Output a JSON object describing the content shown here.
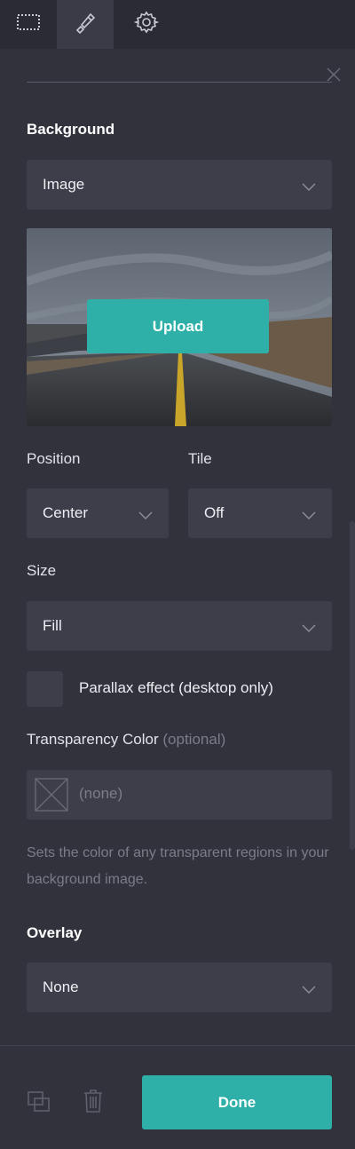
{
  "tabs": [
    {
      "name": "layout-tab",
      "icon": "dotted-rectangle-icon"
    },
    {
      "name": "style-tab",
      "icon": "brush-icon",
      "active": true
    },
    {
      "name": "settings-tab",
      "icon": "gear-icon"
    }
  ],
  "background": {
    "label": "Background",
    "type_value": "Image",
    "upload_label": "Upload",
    "position_label": "Position",
    "position_value": "Center",
    "tile_label": "Tile",
    "tile_value": "Off",
    "size_label": "Size",
    "size_value": "Fill",
    "parallax_label": "Parallax effect (desktop only)",
    "transparency_label": "Transparency Color",
    "transparency_optional": "(optional)",
    "transparency_value": "(none)",
    "help_text": "Sets the color of any transparent regions in your background image."
  },
  "overlay": {
    "label": "Overlay",
    "value": "None"
  },
  "footer": {
    "done_label": "Done"
  },
  "colors": {
    "accent": "#2eb0a8",
    "panel": "#31323c",
    "field": "#3d3e4a"
  }
}
